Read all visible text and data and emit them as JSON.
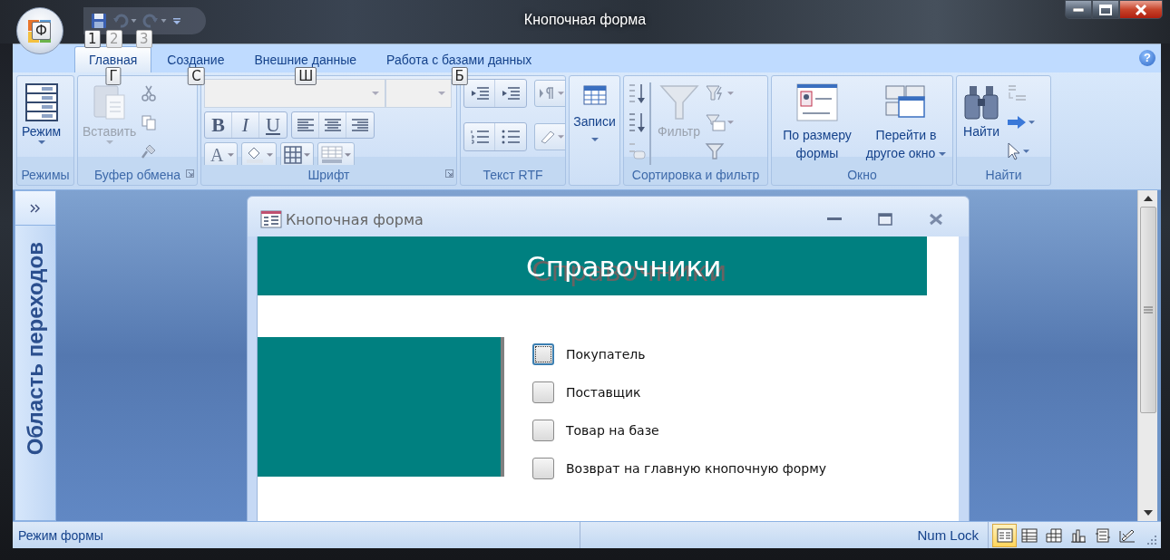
{
  "window": {
    "title": "Кнопочная форма"
  },
  "office_button": {
    "key_tip": "Ф"
  },
  "quick_access": [
    {
      "kind": "save",
      "key_tip": "1",
      "disabled": false
    },
    {
      "kind": "undo",
      "key_tip": "2",
      "disabled": true
    },
    {
      "kind": "redo",
      "key_tip": "3",
      "disabled": true
    }
  ],
  "tabs": [
    {
      "label": "Главная",
      "key_tip": "Г",
      "selected": true
    },
    {
      "label": "Создание",
      "key_tip": "С",
      "selected": false
    },
    {
      "label": "Внешние данные",
      "key_tip": "Ш",
      "selected": false
    },
    {
      "label": "Работа с базами данных",
      "key_tip": "Б",
      "selected": false
    }
  ],
  "help_button": {
    "label": "?"
  },
  "ribbon": {
    "groups": [
      {
        "kind": "modes",
        "label": "Режимы",
        "button": {
          "label": "Режим"
        }
      },
      {
        "kind": "clipboard",
        "label": "Буфер обмена",
        "launcher": true,
        "button": {
          "label": "Вставить",
          "disabled": true
        }
      },
      {
        "kind": "font",
        "label": "Шрифт",
        "launcher": true,
        "format_buttons": [
          "B",
          "I",
          "U"
        ],
        "font_color": "A"
      },
      {
        "kind": "rtf",
        "label": "Текст RTF"
      },
      {
        "kind": "records",
        "button": {
          "label": "Записи"
        }
      },
      {
        "kind": "sort",
        "label": "Сортировка и фильтр",
        "button": {
          "label": "Фильтр",
          "disabled": true
        }
      },
      {
        "kind": "window",
        "label": "Окно",
        "buttons": [
          {
            "label": "По размеру формы"
          },
          {
            "label": "Перейти в другое окно",
            "dropdown": true
          }
        ]
      },
      {
        "kind": "find",
        "label": "Найти",
        "button": {
          "label": "Найти"
        }
      }
    ]
  },
  "nav_pane": {
    "title": "Область переходов"
  },
  "form": {
    "title": "Кнопочная форма",
    "header": "Справочники",
    "items": [
      {
        "label": "Покупатель",
        "selected": true
      },
      {
        "label": "Поставщик",
        "selected": false
      },
      {
        "label": "Товар на базе",
        "selected": false
      },
      {
        "label": "Возврат на главную кнопочную форму",
        "selected": false
      }
    ]
  },
  "status_bar": {
    "mode": "Режим формы",
    "indicator": "Num Lock",
    "views": [
      {
        "kind": "form",
        "selected": true
      },
      {
        "kind": "datasheet",
        "selected": false
      },
      {
        "kind": "pivot-table",
        "selected": false
      },
      {
        "kind": "pivot-chart",
        "selected": false
      },
      {
        "kind": "layout",
        "selected": false
      },
      {
        "kind": "design",
        "selected": false
      }
    ]
  }
}
